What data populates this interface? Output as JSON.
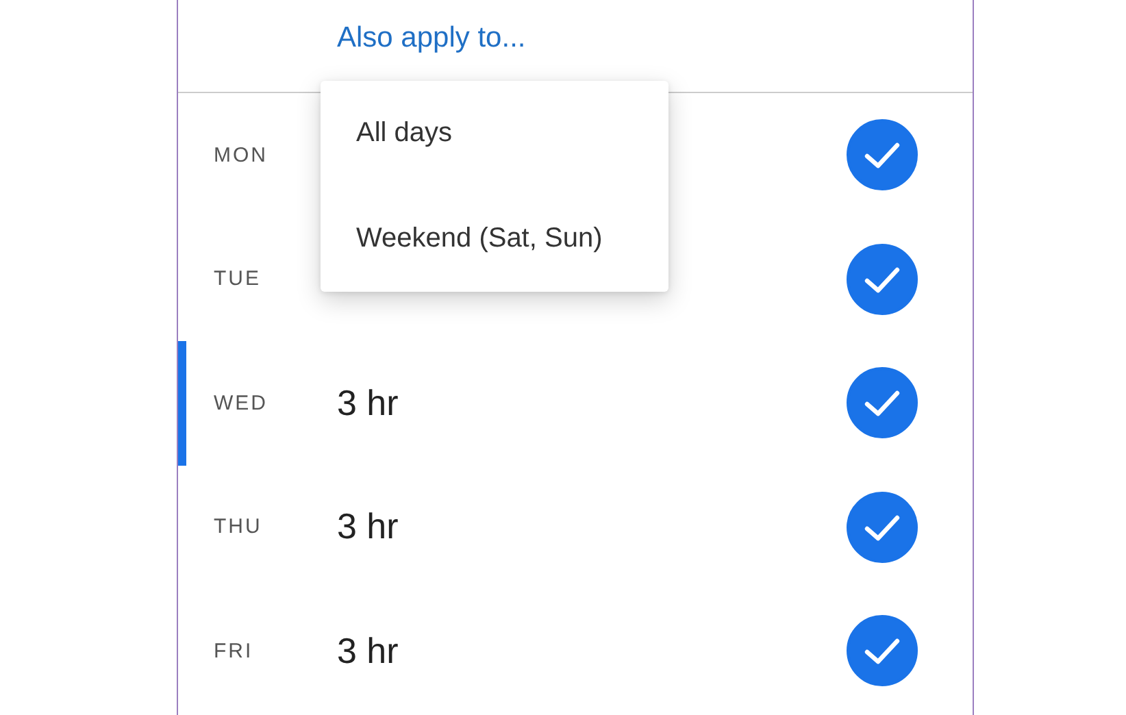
{
  "header": {
    "link": "Also apply to..."
  },
  "menu": {
    "items": [
      {
        "label": "All days"
      },
      {
        "label": "Weekend (Sat, Sun)"
      }
    ]
  },
  "days": [
    {
      "day": "MON",
      "checked": true,
      "selected": false
    },
    {
      "day": "TUE",
      "checked": true,
      "selected": false
    },
    {
      "day": "WED",
      "value": "3 hr",
      "checked": true,
      "selected": true
    },
    {
      "day": "THU",
      "value": "3 hr",
      "checked": true,
      "selected": false
    },
    {
      "day": "FRI",
      "value": "3 hr",
      "checked": true,
      "selected": false
    }
  ]
}
